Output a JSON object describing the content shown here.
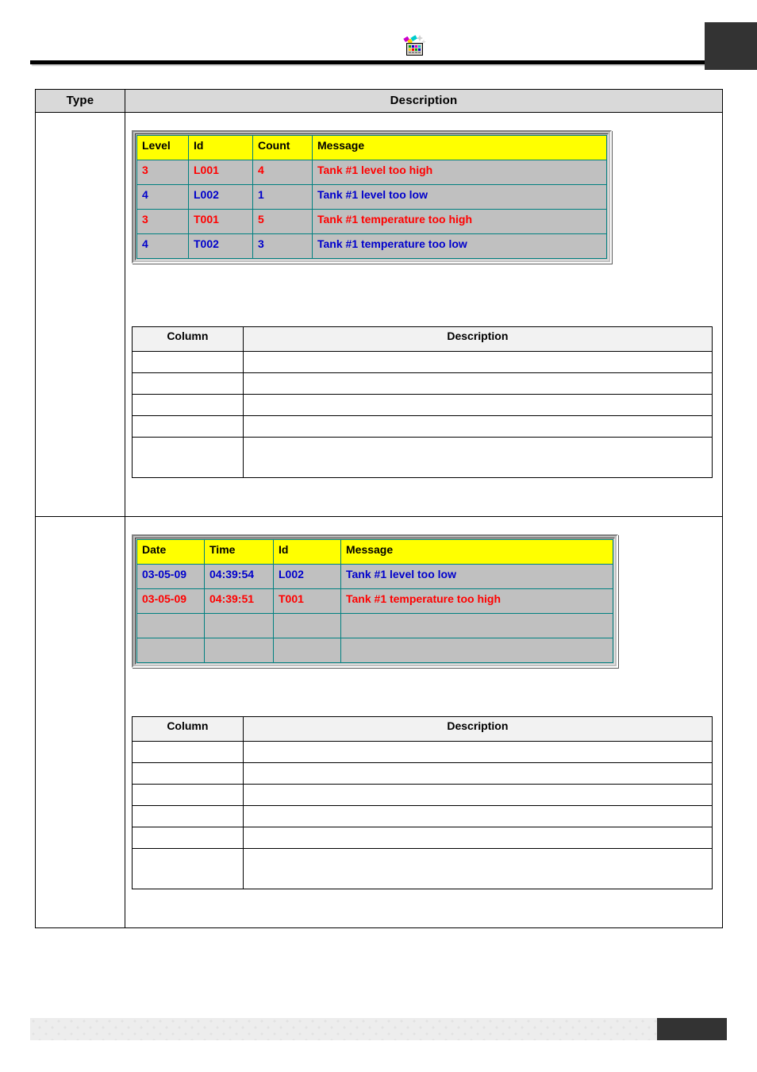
{
  "header": {
    "icon": "alarm-display-wizard-icon",
    "rule": true,
    "corner_tab": "chapter-tab"
  },
  "doc_table": {
    "headers": {
      "type": "Type",
      "description": "Description"
    },
    "sections": [
      {
        "type_label": "",
        "widget": "alarm-summary-display",
        "widget_table": {
          "columns": [
            "Level",
            "Id",
            "Count",
            "Message"
          ],
          "rows": [
            {
              "level": "3",
              "id": "L001",
              "count": "4",
              "message": "Tank #1 level too high",
              "color": "#ff0000"
            },
            {
              "level": "4",
              "id": "L002",
              "count": "1",
              "message": "Tank #1 level too low",
              "color": "#0000cc"
            },
            {
              "level": "3",
              "id": "T001",
              "count": "5",
              "message": "Tank #1 temperature too high",
              "color": "#ff0000"
            },
            {
              "level": "4",
              "id": "T002",
              "count": "3",
              "message": "Tank #1 temperature too low",
              "color": "#0000cc"
            }
          ]
        },
        "spec_table": {
          "headers": {
            "column": "Column",
            "description": "Description"
          },
          "rows": [
            {
              "column": "",
              "description": "",
              "tall": false
            },
            {
              "column": "",
              "description": "",
              "tall": false
            },
            {
              "column": "",
              "description": "",
              "tall": false
            },
            {
              "column": "",
              "description": "",
              "tall": false
            },
            {
              "column": "",
              "description": "",
              "tall": true
            }
          ]
        }
      },
      {
        "type_label": "",
        "widget": "event-log-display",
        "widget_table": {
          "columns": [
            "Date",
            "Time",
            "Id",
            "Message"
          ],
          "rows": [
            {
              "date": "03-05-09",
              "time": "04:39:54",
              "id": "L002",
              "message": "Tank #1 level too low",
              "color": "#0000cc"
            },
            {
              "date": "03-05-09",
              "time": "04:39:51",
              "id": "T001",
              "message": "Tank #1 temperature too high",
              "color": "#ff0000"
            },
            {
              "date": "",
              "time": "",
              "id": "",
              "message": "",
              "color": "#0000cc"
            },
            {
              "date": "",
              "time": "",
              "id": "",
              "message": "",
              "color": "#0000cc"
            }
          ]
        },
        "spec_table": {
          "headers": {
            "column": "Column",
            "description": "Description"
          },
          "rows": [
            {
              "column": "",
              "description": "",
              "tall": false
            },
            {
              "column": "",
              "description": "",
              "tall": false
            },
            {
              "column": "",
              "description": "",
              "tall": false
            },
            {
              "column": "",
              "description": "",
              "tall": false
            },
            {
              "column": "",
              "description": "",
              "tall": false
            },
            {
              "column": "",
              "description": "",
              "tall": true
            }
          ]
        }
      }
    ]
  },
  "colors": {
    "alarm_high": "#ff0000",
    "alarm_low": "#0000cc",
    "widget_header_bg": "#ffff00",
    "widget_row_bg": "#c0c0c0",
    "widget_gridline": "#008080",
    "doc_header_bg": "#d9d9d9",
    "spec_header_bg": "#f2f2f2",
    "tab_dark": "#333333"
  }
}
